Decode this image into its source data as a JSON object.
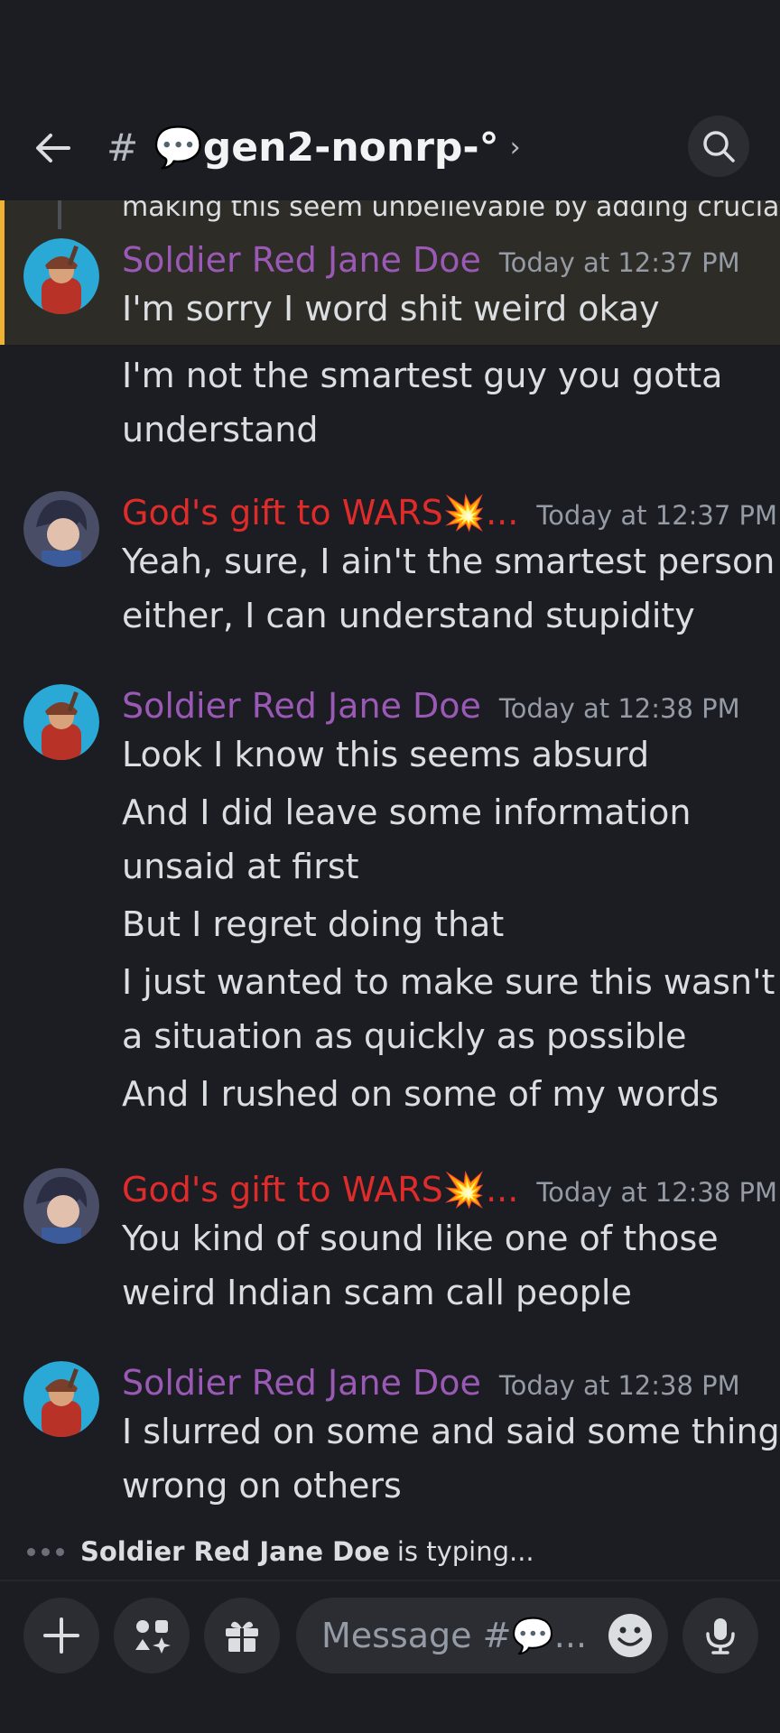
{
  "header": {
    "hash": "#",
    "channel": "💬gen2-nonrp-°",
    "chevron": "›",
    "icons": {
      "back": "arrow-left-icon",
      "search": "search-icon"
    }
  },
  "cutoff_text": "making this seem unbelievable by adding crucial",
  "messages": [
    {
      "author": "Soldier Red Jane Doe",
      "timestamp": "Today at 12:37 PM",
      "lines": [
        "I'm sorry I word shit weird okay",
        "I'm not the smartest guy you gotta",
        "understand"
      ]
    },
    {
      "author": "God's gift to WARS💥...",
      "timestamp": "Today at 12:37 PM",
      "lines": [
        "Yeah, sure, I ain't the smartest person",
        "either, I can understand stupidity"
      ]
    },
    {
      "author": "Soldier Red Jane Doe",
      "timestamp": "Today at 12:38 PM",
      "lines": [
        "Look I know this seems absurd",
        "And I did leave some information",
        "unsaid at first",
        "But I regret doing that",
        "I just wanted to make sure this wasn't",
        "a situation as quickly as possible",
        "And I rushed on some of my words"
      ]
    },
    {
      "author": "God's gift to WARS💥...",
      "timestamp": "Today at 12:38 PM",
      "lines": [
        "You kind of sound like one of those",
        "weird Indian scam call people"
      ]
    },
    {
      "author": "Soldier Red Jane Doe",
      "timestamp": "Today at 12:38 PM",
      "lines": [
        "I slurred on some and said some things",
        "wrong on others"
      ]
    }
  ],
  "typing": {
    "user": "Soldier Red Jane Doe",
    "suffix": "is typing..."
  },
  "composer": {
    "placeholder": "Message #💬...",
    "icons": [
      "plus-icon",
      "apps-icon",
      "gift-icon",
      "emoji-icon",
      "microphone-icon"
    ]
  },
  "colors": {
    "purple_author": "#9b59b6",
    "red_author": "#e02b2b",
    "highlight_bar": "#f0b232",
    "background": "#1c1d22"
  }
}
